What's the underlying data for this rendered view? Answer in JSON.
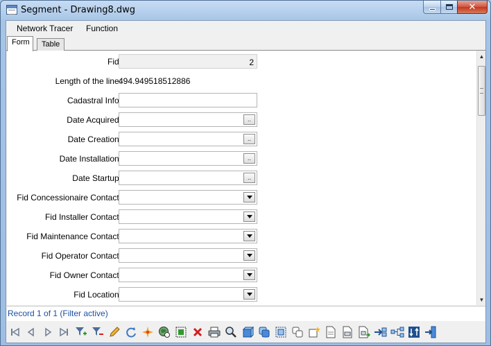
{
  "window": {
    "title": "Segment - Drawing8.dwg",
    "close_glyph": "✕"
  },
  "menu": {
    "items": [
      "Network Tracer",
      "Function"
    ]
  },
  "tabs": [
    "Form",
    "Table"
  ],
  "form": {
    "fid": {
      "label": "Fid:",
      "value": "2"
    },
    "length": {
      "label": "Length of the line:",
      "value": "494.949518512886"
    },
    "cadastral": {
      "label": "Cadastral Info:",
      "value": ""
    },
    "date_acquired": {
      "label": "Date Acquired:",
      "value": ""
    },
    "date_creation": {
      "label": "Date Creation:",
      "value": ""
    },
    "date_installation": {
      "label": "Date Installation:",
      "value": ""
    },
    "date_startup": {
      "label": "Date Startup:",
      "value": ""
    },
    "fid_concessionaire": {
      "label": "Fid Concessionaire Contact:",
      "value": ""
    },
    "fid_installer": {
      "label": "Fid Installer Contact:",
      "value": ""
    },
    "fid_maintenance": {
      "label": "Fid Maintenance Contact:",
      "value": ""
    },
    "fid_operator": {
      "label": "Fid Operator Contact:",
      "value": ""
    },
    "fid_owner": {
      "label": "Fid Owner Contact:",
      "value": ""
    },
    "fid_location": {
      "label": "Fid Location:",
      "value": ""
    },
    "browse_glyph": "..",
    "dropdown_glyph": "▼"
  },
  "status": {
    "text": "Record 1 of 1 (Filter active)"
  },
  "toolbar": {
    "icons": [
      "first-record-icon",
      "previous-record-icon",
      "next-record-icon",
      "last-record-icon",
      "add-filter-icon",
      "remove-filter-icon",
      "edit-icon",
      "refresh-icon",
      "highlight-icon",
      "zoom-globe-icon",
      "select-objects-icon",
      "delete-icon",
      "print-icon",
      "zoom-icon",
      "box-3d-icon",
      "copy-shapes-icon",
      "select-frame-icon",
      "duplicate-icon",
      "new-document-icon",
      "document-icon",
      "report-icon",
      "report-export-icon",
      "link-in-icon",
      "network-icon",
      "sort-icon",
      "exit-icon"
    ],
    "colors": {
      "accent_blue": "#1e50a2",
      "delete_red": "#d21c1c",
      "filter_green": "#2f9a2f"
    }
  }
}
